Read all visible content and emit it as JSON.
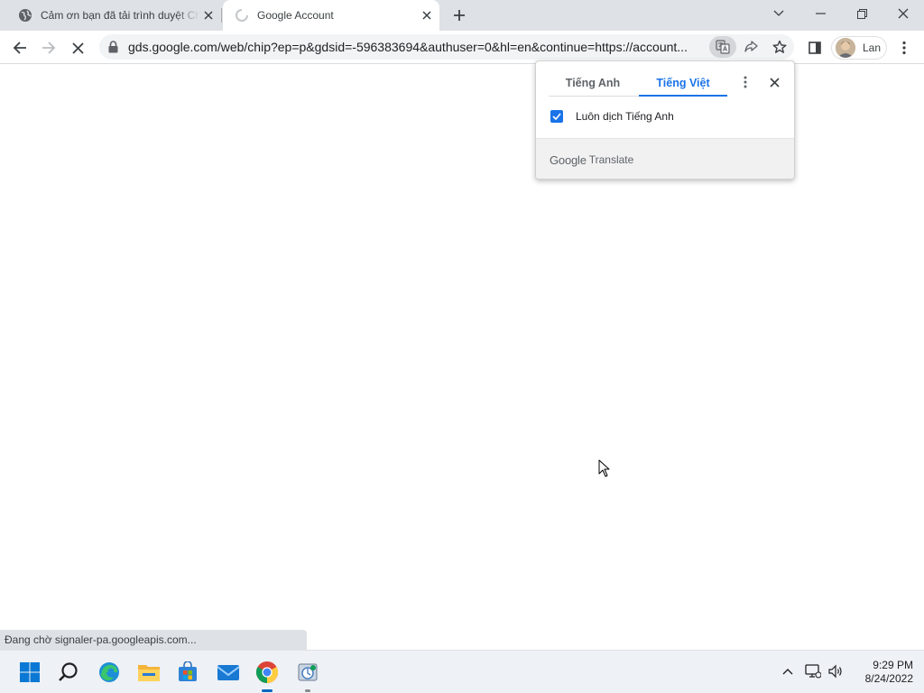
{
  "tabs": [
    {
      "title": "Cảm ơn bạn đã tải trình duyệt Chrome",
      "favicon": "globe-icon",
      "active": false
    },
    {
      "title": "Google Account",
      "favicon": "loading-spinner-icon",
      "active": true
    }
  ],
  "window_controls": [
    "chevron-down-icon",
    "minimize-icon",
    "restore-icon",
    "close-icon"
  ],
  "toolbar": {
    "url": "gds.google.com/web/chip?ep=p&gdsid=-596383694&authuser=0&hl=en&continue=https://account...",
    "profile_name": "Lan"
  },
  "translate_popup": {
    "source_language": "Tiếng Anh",
    "target_language": "Tiếng Việt",
    "active_language": "target",
    "always_translate_label": "Luôn dịch Tiếng Anh",
    "always_translate_checked": true,
    "footer_brand": "Google",
    "footer_label": "Translate"
  },
  "status_bar": {
    "text": "Đang chờ signaler-pa.googleapis.com..."
  },
  "taskbar": {
    "apps": [
      "windows-start-icon",
      "search-icon",
      "edge-icon",
      "file-explorer-icon",
      "store-icon",
      "mail-icon",
      "chrome-icon",
      "setup-icon"
    ],
    "active_app": "chrome-icon",
    "clock_time": "9:29 PM",
    "clock_date": "8/24/2022"
  },
  "colors": {
    "accent": "#1a73e8",
    "tabstrip": "#dee1e6",
    "taskbar": "#eef1f5"
  }
}
